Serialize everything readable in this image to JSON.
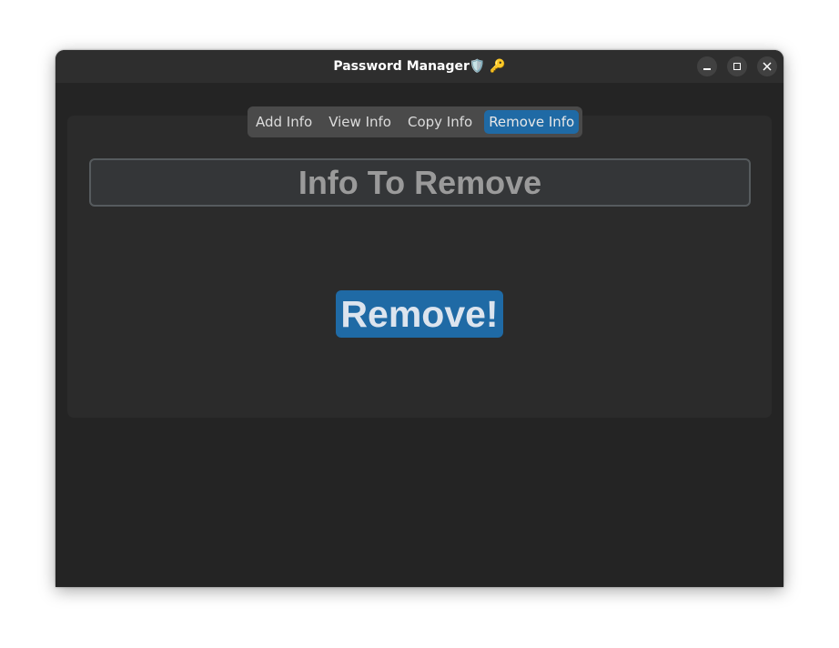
{
  "window": {
    "title": "Password Manager🛡️ 🔑"
  },
  "tabs": [
    {
      "label": "Add Info",
      "active": false
    },
    {
      "label": "View Info",
      "active": false
    },
    {
      "label": "Copy Info",
      "active": false
    },
    {
      "label": "Remove Info",
      "active": true
    }
  ],
  "form": {
    "placeholder": "Info To Remove",
    "value": "",
    "button_label": "Remove!"
  },
  "colors": {
    "accent": "#1f6aa5",
    "window_bg": "#242424",
    "panel_bg": "#2b2b2b",
    "entry_bg": "#343638"
  }
}
